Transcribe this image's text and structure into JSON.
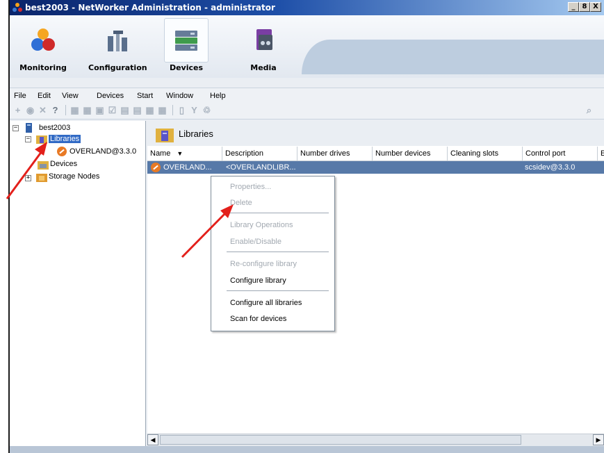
{
  "window": {
    "title": "best2003 - NetWorker Administration - administrator",
    "controls": [
      "_",
      "8",
      "X"
    ]
  },
  "launcher": [
    {
      "label": "Monitoring",
      "icon": "monitoring-icon"
    },
    {
      "label": "Configuration",
      "icon": "configuration-icon"
    },
    {
      "label": "Devices",
      "icon": "devices-icon",
      "active": true
    },
    {
      "label": "Media",
      "icon": "media-icon"
    }
  ],
  "menubar": [
    "File",
    "Edit",
    "View",
    "Devices",
    "Start",
    "Window",
    "Help"
  ],
  "tree": {
    "root": "best2003",
    "libraries": "Libraries",
    "library_item": "OVERLAND@3.3.0",
    "devices": "Devices",
    "storage_nodes": "Storage Nodes"
  },
  "pane": {
    "title": "Libraries",
    "columns": [
      "Name",
      "Description",
      "Number drives",
      "Number devices",
      "Cleaning slots",
      "Control port",
      "Er"
    ],
    "rows": [
      {
        "name": "OVERLAND...",
        "description": "<OVERLANDLIBR...",
        "control_port": "scsidev@3.3.0"
      }
    ]
  },
  "context_menu": {
    "items": [
      {
        "label": "Properties...",
        "enabled": false
      },
      {
        "label": "Delete",
        "enabled": false
      },
      {
        "label": "Library Operations",
        "enabled": false
      },
      {
        "label": "Enable/Disable",
        "enabled": false
      },
      {
        "label": "Re-configure library",
        "enabled": false
      },
      {
        "label": "Configure library",
        "enabled": true
      },
      {
        "label": "Configure all libraries",
        "enabled": true
      },
      {
        "label": "Scan for devices",
        "enabled": true
      }
    ]
  },
  "scrollbar": {
    "left_arrow": "◀",
    "right_arrow": "▶"
  },
  "colors": {
    "selection": "#5779a8",
    "tree_selection": "#316ac5",
    "annotation_arrow": "#e3201b"
  }
}
